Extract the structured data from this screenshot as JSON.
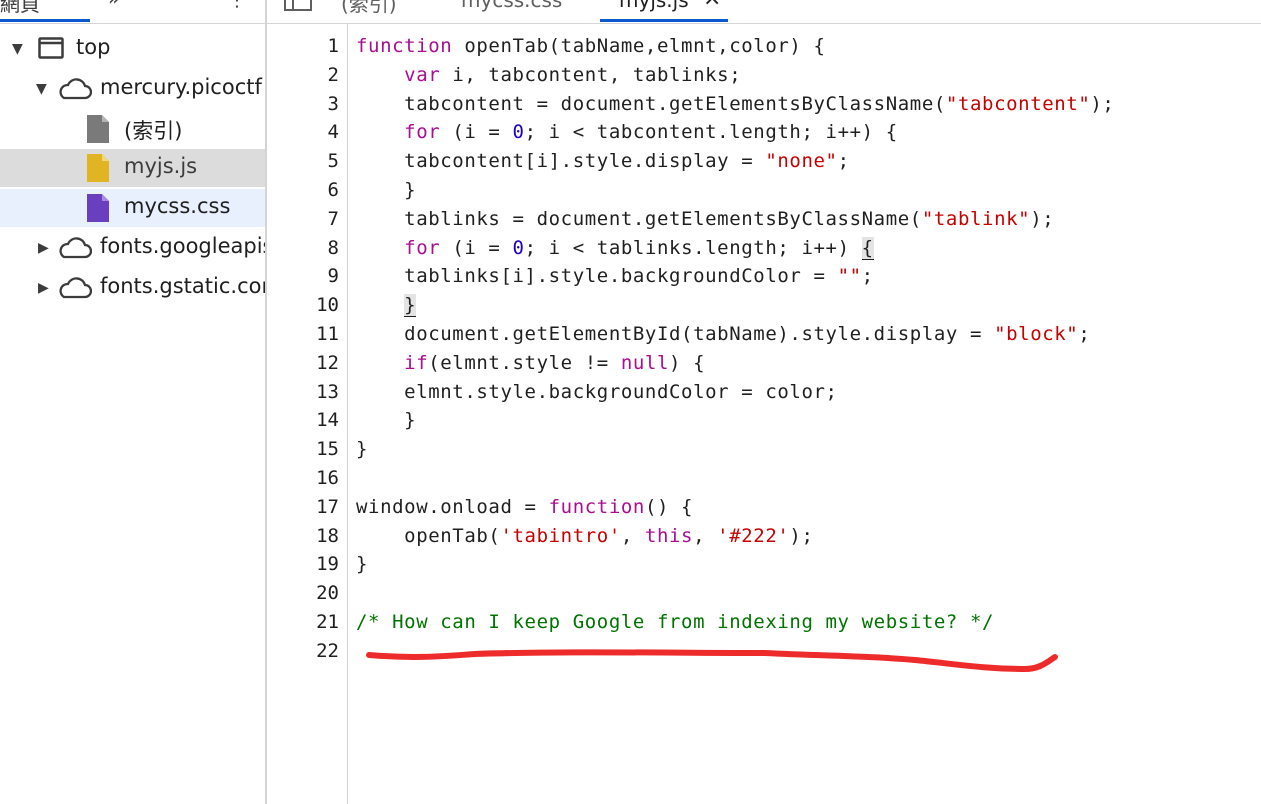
{
  "left_tabs": {
    "page_label": "網頁",
    "more_label": "»",
    "menu_label": "⋮"
  },
  "tree": {
    "top": "top",
    "mercury": "mercury.picoctf",
    "index": "(索引)",
    "myjs": "myjs.js",
    "mycss": "mycss.css",
    "fonts_googleapis": "fonts.googleapis",
    "fonts_gstatic": "fonts.gstatic.com"
  },
  "editor_tabs": {
    "index": "(索引)",
    "mycss": "mycss.css",
    "myjs": "myjs.js",
    "close": "×"
  },
  "colors": {
    "accent": "#0b57d0",
    "keyword": "#aa0d91",
    "string": "#c80000",
    "number": "#1c00cf",
    "comment": "#007400",
    "annotation": "#ee2b2b"
  },
  "code_lines": [
    {
      "n": "1",
      "tokens": [
        [
          "kw",
          "function"
        ],
        [
          "p",
          " openTab(tabName,elmnt,color) {"
        ]
      ]
    },
    {
      "n": "2",
      "tokens": [
        [
          "p",
          "    "
        ],
        [
          "kw",
          "var"
        ],
        [
          "p",
          " i, tabcontent, tablinks;"
        ]
      ]
    },
    {
      "n": "3",
      "tokens": [
        [
          "p",
          "    tabcontent = document.getElementsByClassName("
        ],
        [
          "str",
          "\"tabcontent\""
        ],
        [
          "p",
          ");"
        ]
      ]
    },
    {
      "n": "4",
      "tokens": [
        [
          "p",
          "    "
        ],
        [
          "kw",
          "for"
        ],
        [
          "p",
          " (i = "
        ],
        [
          "num",
          "0"
        ],
        [
          "p",
          "; i < tabcontent.length; i++) {"
        ]
      ]
    },
    {
      "n": "5",
      "tokens": [
        [
          "p",
          "    tabcontent[i].style.display = "
        ],
        [
          "str",
          "\"none\""
        ],
        [
          "p",
          ";"
        ]
      ]
    },
    {
      "n": "6",
      "tokens": [
        [
          "p",
          "    }"
        ]
      ]
    },
    {
      "n": "7",
      "tokens": [
        [
          "p",
          "    tablinks = document.getElementsByClassName("
        ],
        [
          "str",
          "\"tablink\""
        ],
        [
          "p",
          ");"
        ]
      ]
    },
    {
      "n": "8",
      "tokens": [
        [
          "p",
          "    "
        ],
        [
          "kw",
          "for"
        ],
        [
          "p",
          " (i = "
        ],
        [
          "num",
          "0"
        ],
        [
          "p",
          "; i < tablinks.length; i++) "
        ],
        [
          "hl",
          "{"
        ]
      ]
    },
    {
      "n": "9",
      "tokens": [
        [
          "p",
          "    tablinks[i].style.backgroundColor = "
        ],
        [
          "str",
          "\"\""
        ],
        [
          "p",
          ";"
        ]
      ]
    },
    {
      "n": "10",
      "tokens": [
        [
          "p",
          "    "
        ],
        [
          "hl",
          "}"
        ]
      ]
    },
    {
      "n": "11",
      "tokens": [
        [
          "p",
          "    document.getElementById(tabName).style.display = "
        ],
        [
          "str",
          "\"block\""
        ],
        [
          "p",
          ";"
        ]
      ]
    },
    {
      "n": "12",
      "tokens": [
        [
          "p",
          "    "
        ],
        [
          "kw",
          "if"
        ],
        [
          "p",
          "(elmnt.style != "
        ],
        [
          "kw",
          "null"
        ],
        [
          "p",
          ") {"
        ]
      ]
    },
    {
      "n": "13",
      "tokens": [
        [
          "p",
          "    elmnt.style.backgroundColor = color;"
        ]
      ]
    },
    {
      "n": "14",
      "tokens": [
        [
          "p",
          "    }"
        ]
      ]
    },
    {
      "n": "15",
      "tokens": [
        [
          "p",
          "}"
        ]
      ]
    },
    {
      "n": "16",
      "tokens": [
        [
          "p",
          ""
        ]
      ]
    },
    {
      "n": "17",
      "tokens": [
        [
          "p",
          "window.onload = "
        ],
        [
          "kw",
          "function"
        ],
        [
          "p",
          "() {"
        ]
      ]
    },
    {
      "n": "18",
      "tokens": [
        [
          "p",
          "    openTab("
        ],
        [
          "str",
          "'tabintro'"
        ],
        [
          "p",
          ", "
        ],
        [
          "kw",
          "this"
        ],
        [
          "p",
          ", "
        ],
        [
          "str",
          "'#222'"
        ],
        [
          "p",
          ");"
        ]
      ]
    },
    {
      "n": "19",
      "tokens": [
        [
          "p",
          "}"
        ]
      ]
    },
    {
      "n": "20",
      "tokens": [
        [
          "p",
          ""
        ]
      ]
    },
    {
      "n": "21",
      "tokens": [
        [
          "cmt",
          "/* How can I keep Google from indexing my website? */"
        ]
      ]
    },
    {
      "n": "22",
      "tokens": [
        [
          "p",
          ""
        ]
      ]
    }
  ]
}
